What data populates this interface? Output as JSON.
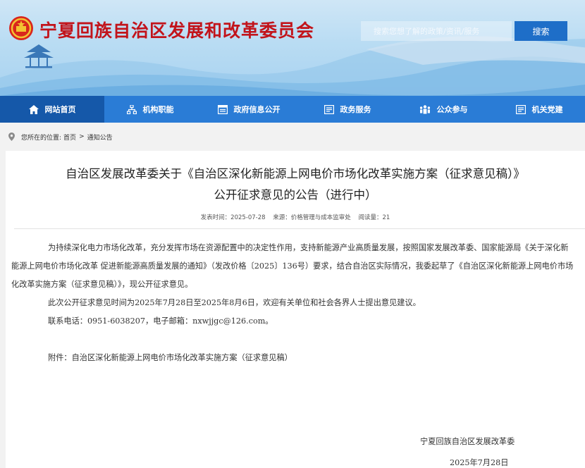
{
  "site": {
    "title": "宁夏回族自治区发展和改革委员会",
    "search_placeholder": "搜索您想了解的政策/资讯/服务",
    "search_button": "搜索",
    "colors": {
      "title_red": "#c2141b",
      "nav_blue": "#2a7cd6",
      "nav_active": "#1558a9",
      "search_btn": "#1e6ec8"
    }
  },
  "nav": {
    "items": [
      {
        "label": "网站首页",
        "icon": "home-icon",
        "active": true
      },
      {
        "label": "机构职能",
        "icon": "org-chart-icon",
        "active": false
      },
      {
        "label": "政府信息公开",
        "icon": "info-list-icon",
        "active": false
      },
      {
        "label": "政务服务",
        "icon": "service-icon",
        "active": false
      },
      {
        "label": "公众参与",
        "icon": "people-icon",
        "active": false
      },
      {
        "label": "机关党建",
        "icon": "party-icon",
        "active": false
      }
    ]
  },
  "breadcrumb": {
    "prefix": "您所在的位置:",
    "home": "首页",
    "separator": ">",
    "current": "通知公告"
  },
  "article": {
    "title_line1": "自治区发展改革委关于《自治区深化新能源上网电价市场化改革实施方案（征求意见稿）》",
    "title_line2": "公开征求意见的公告（进行中）",
    "publish_time": "发表时间：2025-07-28",
    "source": "来源：价格管理与成本监审处",
    "views": "阅读量：21",
    "para1": "为持续深化电力市场化改革，充分发挥市场在资源配置中的决定性作用，支持新能源产业高质量发展，按照国家发展改革委、国家能源局《关于深化新能源上网电价市场化改革 促进新能源高质量发展的通知》（发改价格〔2025〕136号）要求，结合自治区实际情况，我委起草了《自治区深化新能源上网电价市场化改革实施方案（征求意见稿）》，现公开征求意见。",
    "para2": "此次公开征求意见时间为2025年7月28日至2025年8月6日，欢迎有关单位和社会各界人士提出意见建议。",
    "para3": "联系电话：0951-6038207，电子邮箱：nxwjjgc@126.com。",
    "attachment_label": "附件：",
    "attachment_link": "自治区深化新能源上网电价市场化改革实施方案（征求意见稿）",
    "signature": "宁夏回族自治区发展改革委",
    "date": "2025年7月28日"
  }
}
